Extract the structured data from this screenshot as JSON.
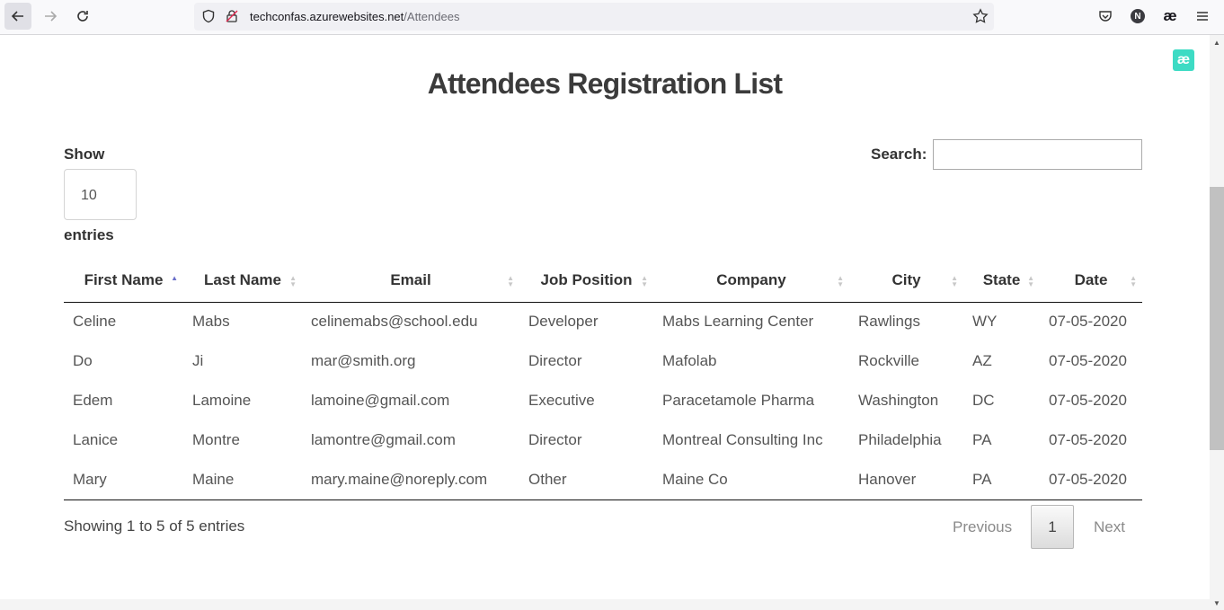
{
  "browser": {
    "url_host": "techconfas.azurewebsites.net",
    "url_path": "/Attendees",
    "profile_initial": "N",
    "ext_glyph": "æ"
  },
  "page": {
    "title": "Attendees Registration List",
    "show_label": "Show",
    "length_value": "10",
    "entries_label": "entries",
    "search_label": "Search:",
    "search_value": ""
  },
  "table": {
    "columns": [
      {
        "label": "First Name",
        "sort": "asc"
      },
      {
        "label": "Last Name",
        "sort": "none"
      },
      {
        "label": "Email",
        "sort": "none"
      },
      {
        "label": "Job Position",
        "sort": "none"
      },
      {
        "label": "Company",
        "sort": "none"
      },
      {
        "label": "City",
        "sort": "none"
      },
      {
        "label": "State",
        "sort": "none"
      },
      {
        "label": "Date",
        "sort": "none"
      }
    ],
    "rows": [
      [
        "Celine",
        "Mabs",
        "celinemabs@school.edu",
        "Developer",
        "Mabs Learning Center",
        "Rawlings",
        "WY",
        "07-05-2020"
      ],
      [
        "Do",
        "Ji",
        "mar@smith.org",
        "Director",
        "Mafolab",
        "Rockville",
        "AZ",
        "07-05-2020"
      ],
      [
        "Edem",
        "Lamoine",
        "lamoine@gmail.com",
        "Executive",
        "Paracetamole Pharma",
        "Washington",
        "DC",
        "07-05-2020"
      ],
      [
        "Lanice",
        "Montre",
        "lamontre@gmail.com",
        "Director",
        "Montreal Consulting Inc",
        "Philadelphia",
        "PA",
        "07-05-2020"
      ],
      [
        "Mary",
        "Maine",
        "mary.maine@noreply.com",
        "Other",
        "Maine Co",
        "Hanover",
        "PA",
        "07-05-2020"
      ]
    ]
  },
  "footer": {
    "info": "Showing 1 to 5 of 5 entries",
    "previous": "Previous",
    "page": "1",
    "next": "Next"
  },
  "colors": {
    "ext_badge": "#3ddbc4",
    "sort_active": "#6a6fc9"
  }
}
